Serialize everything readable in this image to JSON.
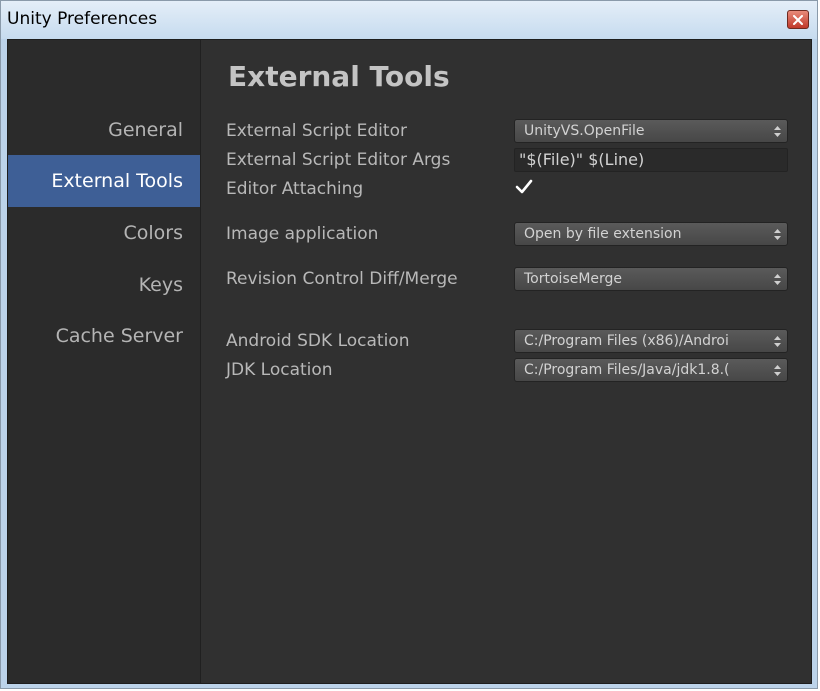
{
  "window": {
    "title": "Unity Preferences"
  },
  "sidebar": {
    "items": [
      {
        "label": "General",
        "selected": false
      },
      {
        "label": "External Tools",
        "selected": true
      },
      {
        "label": "Colors",
        "selected": false
      },
      {
        "label": "Keys",
        "selected": false
      },
      {
        "label": "Cache Server",
        "selected": false
      }
    ]
  },
  "main": {
    "title": "External Tools",
    "external_script_editor": {
      "label": "External Script Editor",
      "value": "UnityVS.OpenFile"
    },
    "external_script_editor_args": {
      "label": "External Script Editor Args",
      "value": "\"$(File)\" $(Line)"
    },
    "editor_attaching": {
      "label": "Editor Attaching",
      "checked": true
    },
    "image_application": {
      "label": "Image application",
      "value": "Open by file extension"
    },
    "revision_control": {
      "label": "Revision Control Diff/Merge",
      "value": "TortoiseMerge"
    },
    "android_sdk": {
      "label": "Android SDK Location",
      "value": "C:/Program Files (x86)/Androi"
    },
    "jdk": {
      "label": "JDK Location",
      "value": "C:/Program Files/Java/jdk1.8.("
    }
  },
  "icons": {
    "close": "close-icon",
    "checkmark": "checkmark-icon",
    "popup_arrows": "up-down-arrows-icon"
  },
  "colors": {
    "panel_background": "#303030",
    "sidebar_background": "#2b2b2b",
    "selection": "#3e5f96",
    "text": "#b8b8b8",
    "title_bar": "#c6dbef",
    "close_button": "#c0392b"
  }
}
